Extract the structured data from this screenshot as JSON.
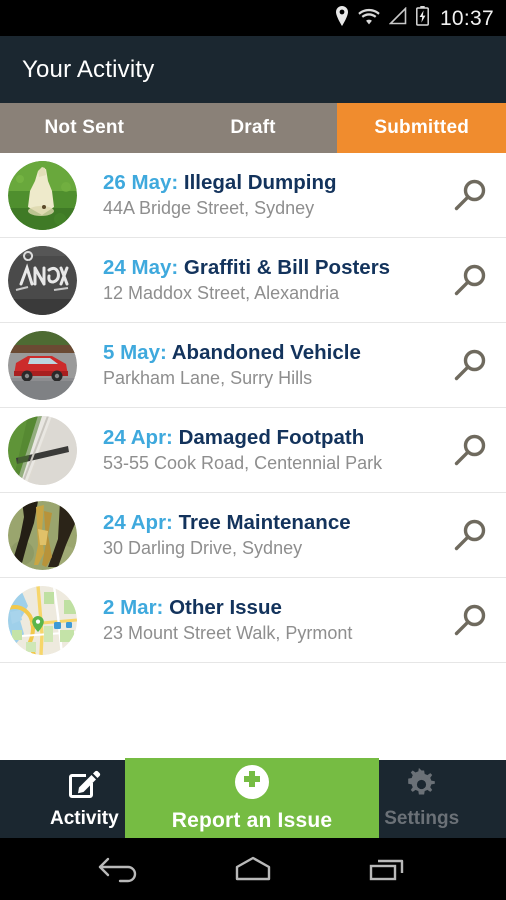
{
  "status_bar": {
    "time": "10:37",
    "icons": [
      "location-pin-icon",
      "wifi-icon",
      "cell-signal-icon",
      "battery-charging-icon"
    ]
  },
  "header": {
    "title": "Your Activity",
    "background": "#1b2730"
  },
  "tabs": {
    "active_index": 2,
    "active_color": "#f08c2e",
    "inactive_color": "#8a8178",
    "items": [
      {
        "label": "Not Sent"
      },
      {
        "label": "Draft"
      },
      {
        "label": "Submitted"
      }
    ]
  },
  "list": {
    "action_icon": "magnifier-icon",
    "date_color": "#3fa9dd",
    "category_color": "#13335c",
    "address_color": "#8e8e8e",
    "items": [
      {
        "date": "26 May:",
        "category": "Illegal Dumping",
        "address": "44A Bridge Street, Sydney",
        "thumbnail": "dumped-bag-on-grass-photo"
      },
      {
        "date": "24 May:",
        "category": "Graffiti & Bill Posters",
        "address": "12 Maddox Street, Alexandria",
        "thumbnail": "graffiti-wall-photo"
      },
      {
        "date": "5 May:",
        "category": "Abandoned Vehicle",
        "address": "Parkham Lane, Surry Hills",
        "thumbnail": "red-car-photo"
      },
      {
        "date": "24 Apr:",
        "category": "Damaged Footpath",
        "address": "53-55 Cook Road, Centennial Park",
        "thumbnail": "cracked-footpath-photo"
      },
      {
        "date": "24 Apr:",
        "category": "Tree Maintenance",
        "address": "30 Darling Drive, Sydney",
        "thumbnail": "damaged-tree-photo"
      },
      {
        "date": "2 Mar:",
        "category": "Other Issue",
        "address": "23 Mount Street Walk, Pyrmont",
        "thumbnail": "map-location-thumbnail"
      }
    ]
  },
  "bottom_nav": {
    "background": "#1b2730",
    "activity": {
      "label": "Activity",
      "icon": "edit-square-icon"
    },
    "report": {
      "label": "Report an Issue",
      "icon": "plus-circle-icon",
      "color": "#76bc43"
    },
    "settings": {
      "label": "Settings",
      "icon": "gear-icon"
    }
  },
  "android_nav": {
    "back": "back-arrow-icon",
    "home": "home-icon",
    "recents": "recent-apps-icon"
  }
}
